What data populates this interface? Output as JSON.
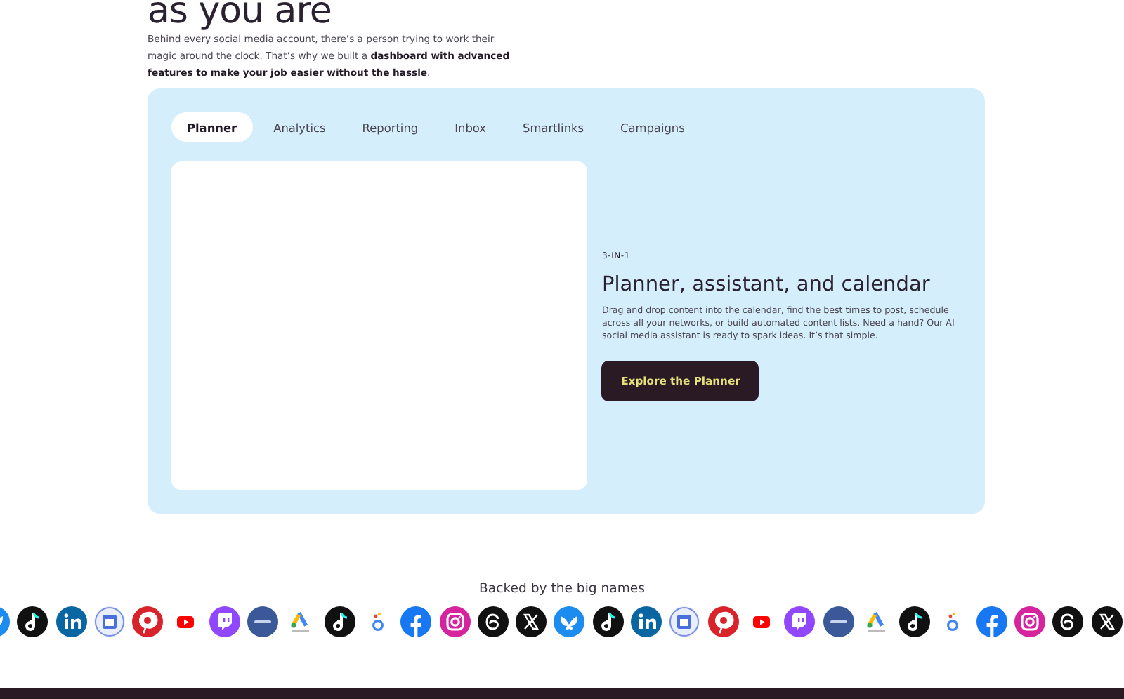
{
  "heading": "as you are",
  "intro": "Behind every social media account, there’s a person trying to work their magic around the clock. That’s why we built a **dashboard with advanced features to make your job easier without the hassle**.",
  "tabs": [
    {
      "label": "Planner",
      "selected": true
    },
    {
      "label": "Analytics",
      "selected": false
    },
    {
      "label": "Reporting",
      "selected": false
    },
    {
      "label": "Inbox",
      "selected": false
    },
    {
      "label": "Smartlinks",
      "selected": false
    },
    {
      "label": "Campaigns",
      "selected": false
    }
  ],
  "feature": {
    "eyebrow": "3-IN-1",
    "title": "Planner, assistant, and calendar",
    "body": "Drag and drop content into the calendar, find the best times to post, schedule across all your networks, or build automated content lists. Need a hand? Our AI social media assistant is ready to spark ideas. It’s that simple.",
    "button": "Explore the Planner"
  },
  "partners": {
    "title": "Backed by the big names"
  }
}
